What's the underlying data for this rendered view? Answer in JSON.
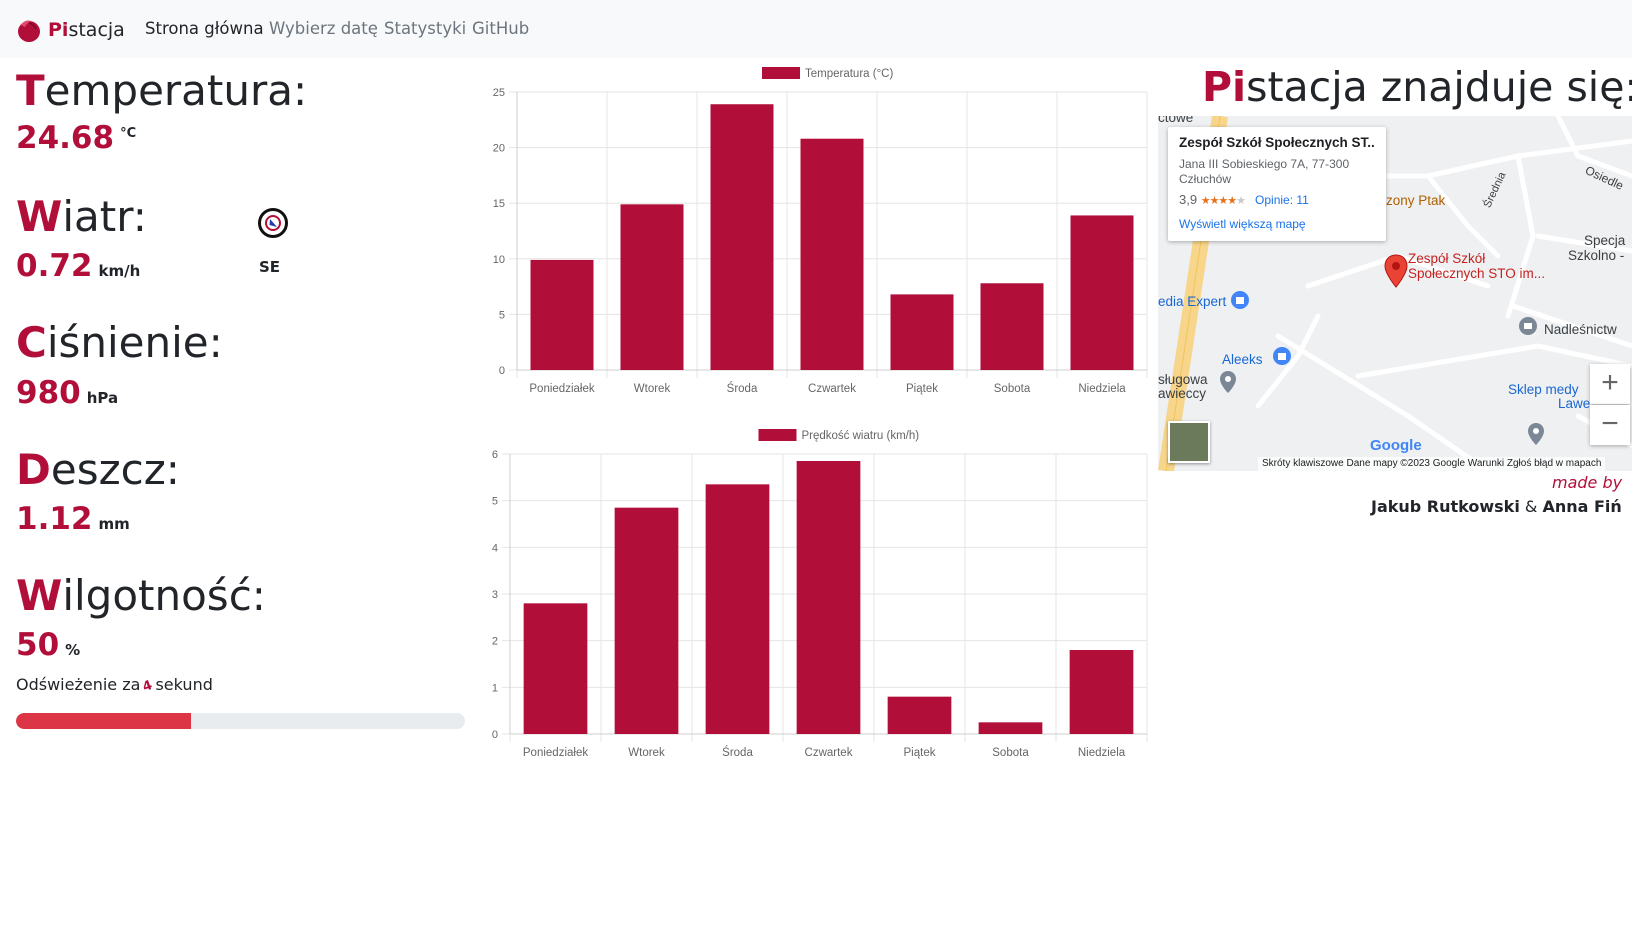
{
  "navbar": {
    "brand": {
      "accent": "Pi",
      "rest": "stacja"
    },
    "links": [
      "Strona główna",
      "Wybierz datę",
      "Statystyki",
      "GitHub"
    ],
    "active_index": 0
  },
  "metrics": {
    "temperature": {
      "first": "T",
      "rest": "emperatura:",
      "value": "24.68",
      "unit": "°C"
    },
    "wind": {
      "first": "W",
      "rest": "iatr:",
      "value": "0.72",
      "unit": "km/h",
      "direction": "SE"
    },
    "pressure": {
      "first": "C",
      "rest": "iśnienie:",
      "value": "980",
      "unit": "hPa"
    },
    "rain": {
      "first": "D",
      "rest": "eszcz:",
      "value": "1.12",
      "unit": "mm"
    },
    "humidity": {
      "first": "W",
      "rest": "ilgotność:",
      "value": "50",
      "unit": "%"
    }
  },
  "refresh": {
    "prefix": "Odświeżenie za",
    "counter": "4",
    "suffix": "sekund",
    "progress": 0.39
  },
  "chart_data": [
    {
      "type": "bar",
      "legend": "Temperatura (°C)",
      "categories": [
        "Poniedziałek",
        "Wtorek",
        "Środa",
        "Czwartek",
        "Piątek",
        "Sobota",
        "Niedziela"
      ],
      "values": [
        9.9,
        14.9,
        23.9,
        20.8,
        6.8,
        7.8,
        13.9
      ],
      "ylim": [
        0,
        25
      ],
      "yticks": [
        0,
        5,
        10,
        15,
        20,
        25
      ],
      "color": "#b10f3a",
      "grid": true,
      "legend_position": "top"
    },
    {
      "type": "bar",
      "legend": "Prędkość wiatru (km/h)",
      "categories": [
        "Poniedziałek",
        "Wtorek",
        "Środa",
        "Czwartek",
        "Piątek",
        "Sobota",
        "Niedziela"
      ],
      "values": [
        2.8,
        4.85,
        5.35,
        5.85,
        0.8,
        0.25,
        1.8
      ],
      "ylim": [
        0,
        6
      ],
      "yticks": [
        0,
        1,
        2,
        3,
        4,
        5,
        6
      ],
      "color": "#b10f3a",
      "grid": true,
      "legend_position": "top"
    }
  ],
  "location": {
    "title_accent": "Pi",
    "title_rest": "stacja znajduje się:",
    "map": {
      "card_title": "Zespół Szkół Społecznych ST...",
      "card_address": "Jana III Sobieskiego 7A, 77-300 Człuchów",
      "rating": "3,9",
      "stars": "★★★★",
      "stars_dim": "★",
      "reviews": "Opinie: 11",
      "view_larger": "Wyświetl większą mapę",
      "labels": [
        "ctowe",
        "zony Ptak",
        "Średnia",
        "Osiedle",
        "Specja",
        "Szkolno -",
        "Zespół Szkół",
        "Społecznych STO im...",
        "edia Expert",
        "Nadleśnictw",
        "Aleeks",
        "sługowa",
        "awieccy",
        "Sklep medy",
        "Lawe"
      ],
      "google": "Google",
      "footer": "Skróty klawiszowe   Dane mapy ©2023 Google   Warunki   Zgłoś błąd w mapach",
      "zoom_in": "+",
      "zoom_out": "−",
      "pin_color": "#ea4335"
    }
  },
  "credits": {
    "made_by": "made by",
    "author1": "Jakub Rutkowski",
    "and": "&",
    "author2": "Anna Fiń"
  },
  "colors": {
    "accent": "#b10f3a",
    "progress": "#dc3545"
  }
}
